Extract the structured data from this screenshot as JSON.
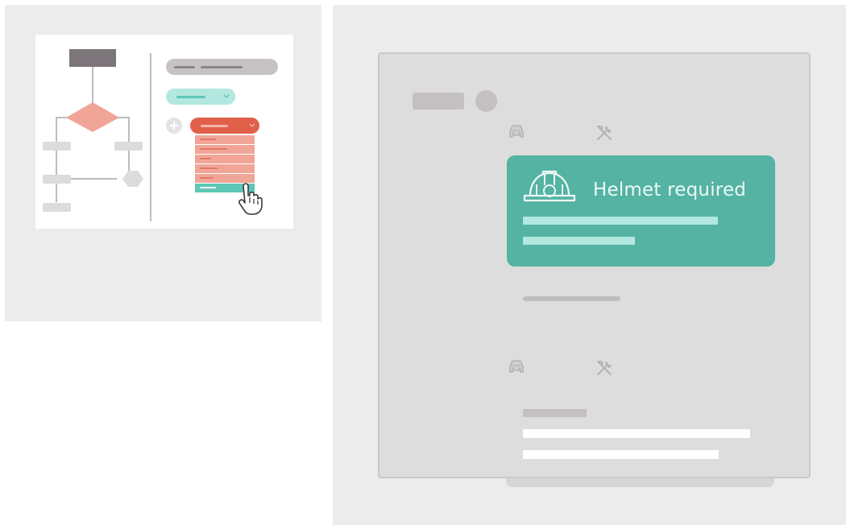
{
  "notice": {
    "title": "Helmet required",
    "icon": "hard-hat-icon"
  },
  "rows": [
    {
      "icons": [
        "car-icon",
        "tools-icon"
      ]
    },
    {
      "icons": [
        "car-icon",
        "tools-icon"
      ]
    }
  ],
  "colors": {
    "panel_bg": "#ececec",
    "window_bg": "#dddddd",
    "accent_teal": "#54b3a3",
    "light_teal": "#b2e8e0",
    "salmon": "#f0a597",
    "coral": "#e0604a",
    "dark_box": "#7c7579"
  }
}
